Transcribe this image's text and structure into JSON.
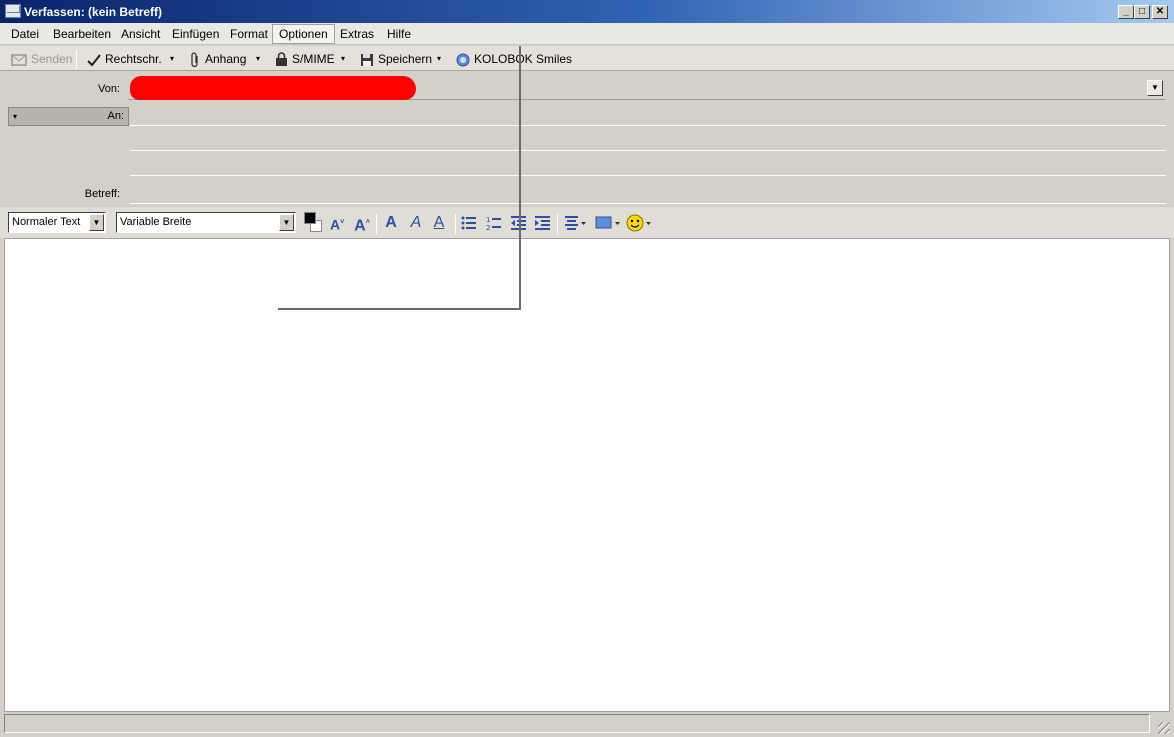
{
  "window": {
    "title": "Verfassen: (kein Betreff)",
    "minimize": "_",
    "maximize": "□",
    "close": "✕"
  },
  "menu": {
    "items": [
      "Datei",
      "Bearbeiten",
      "Ansicht",
      "Einfügen",
      "Format",
      "Optionen",
      "Extras",
      "Hilfe"
    ],
    "active": "Optionen"
  },
  "toolbar": {
    "send_label": "Senden",
    "spell_label": "Rechtschr.",
    "attach_label": "Anhang",
    "smime_label": "S/MIME",
    "save_label": "Speichern",
    "smiles_label": "KOLOBOK Smiles",
    "dropdown_glyph": "▾"
  },
  "header": {
    "from_label": "Von:",
    "to_label": "An:",
    "subject_label": "Betreff:",
    "to_selector_glyph": "▾",
    "combo_glyph": "▼"
  },
  "format_toolbar": {
    "paragraph_style": "Normaler Text",
    "font": "Variable Breite",
    "text_color": "#000000",
    "bg_color": "#ffffff"
  },
  "icons": {
    "send": "send-icon",
    "spell": "checkmark-icon",
    "attach": "paperclip-icon",
    "smime": "lock-icon",
    "save": "floppy-icon",
    "smiles": "smile-globe-icon"
  }
}
